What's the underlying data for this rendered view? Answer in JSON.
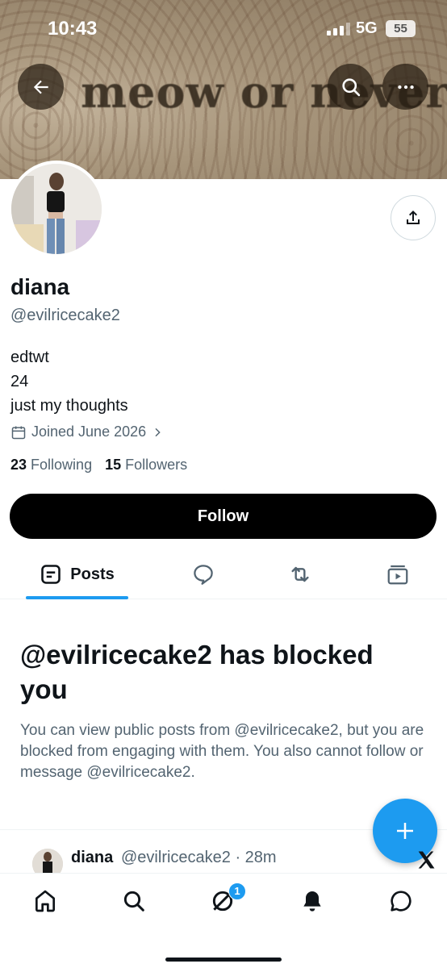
{
  "status_bar": {
    "time": "10:43",
    "network": "5G",
    "battery": "55"
  },
  "banner": {
    "text": "meow or never"
  },
  "profile": {
    "display_name": "diana",
    "handle": "@evilricecake2",
    "bio_lines": [
      "edtwt",
      "24",
      "just my thoughts"
    ],
    "joined": "Joined June 2026",
    "following_count": "23",
    "following_label": "Following",
    "followers_count": "15",
    "followers_label": "Followers"
  },
  "actions": {
    "follow_label": "Follow"
  },
  "tabs": [
    {
      "label": "Posts",
      "icon": "posts-icon",
      "active": true
    },
    {
      "label": "",
      "icon": "replies-icon"
    },
    {
      "label": "",
      "icon": "repost-icon"
    },
    {
      "label": "",
      "icon": "media-icon"
    }
  ],
  "blocked": {
    "title": "@evilricecake2 has blocked you",
    "body": "You can view public posts from @evilricecake2, but you are blocked from engaging with them. You also cannot follow or message @evilricecake2."
  },
  "post_preview": {
    "name": "diana",
    "meta": "@evilricecake2 · 28m"
  },
  "bottom_nav": {
    "items": [
      "home-icon",
      "search-icon",
      "grok-icon",
      "notifications-icon",
      "messages-icon"
    ],
    "grok_badge": "1"
  },
  "colors": {
    "accent": "#1d9bf0",
    "text": "#0f1419",
    "secondary": "#536471",
    "follow_bg": "#000000"
  }
}
